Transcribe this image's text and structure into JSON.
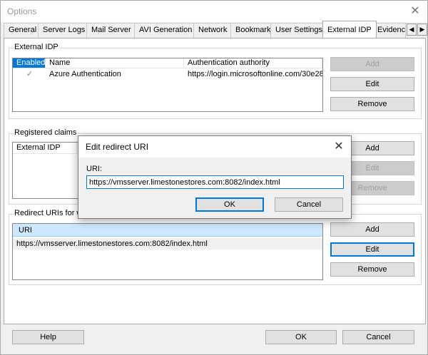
{
  "window": {
    "title": "Options"
  },
  "tabs": [
    {
      "label": "General"
    },
    {
      "label": "Server Logs"
    },
    {
      "label": "Mail Server"
    },
    {
      "label": "AVI Generation"
    },
    {
      "label": "Network"
    },
    {
      "label": "Bookmark"
    },
    {
      "label": "User Settings"
    },
    {
      "label": "External IDP"
    },
    {
      "label": "Evidence L"
    }
  ],
  "external_idp": {
    "group_label": "External IDP",
    "columns": [
      "Enabled",
      "Name",
      "Authentication authority"
    ],
    "rows": [
      {
        "enabled": "✓",
        "name": "Azure Authentication",
        "authority": "https://login.microsoftonline.com/30e28..."
      }
    ],
    "buttons": {
      "add": "Add",
      "edit": "Edit",
      "remove": "Remove"
    }
  },
  "registered_claims": {
    "group_label": "Registered claims",
    "columns": [
      "External IDP"
    ],
    "buttons": {
      "add": "Add",
      "edit": "Edit",
      "remove": "Remove"
    }
  },
  "redirect_uris": {
    "group_label": "Redirect URIs for we",
    "columns": [
      "URI"
    ],
    "rows": [
      "https://vmsserver.limestonestores.com:8082/index.html"
    ],
    "buttons": {
      "add": "Add",
      "edit": "Edit",
      "remove": "Remove"
    }
  },
  "footer": {
    "help": "Help",
    "ok": "OK",
    "cancel": "Cancel"
  },
  "dialog": {
    "title": "Edit redirect URI",
    "uri_label": "URI:",
    "uri_value": "https://vmsserver.limestonestores.com:8082/index.html",
    "ok": "OK",
    "cancel": "Cancel"
  },
  "icons": {
    "close": "close-icon",
    "scroll_left": "chevron-left-icon",
    "scroll_right": "chevron-right-icon"
  },
  "colors": {
    "accent": "#0078d7",
    "selected_header": "#0078d7",
    "selected_row": "#cce8ff"
  }
}
